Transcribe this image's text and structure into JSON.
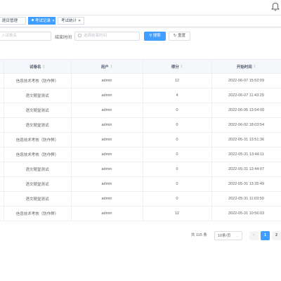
{
  "tabs": [
    {
      "label": "题目管理",
      "active": false
    },
    {
      "label": "考试记录",
      "active": true
    },
    {
      "label": "考试统计",
      "active": false
    }
  ],
  "filter": {
    "name_placeholder": "入试卷名",
    "end_time_label": "结束时间",
    "end_time_placeholder": "选择结束时间",
    "search_label": "搜索",
    "reset_label": "重置"
  },
  "table": {
    "columns": [
      "试卷名",
      "用户",
      "得分",
      "开始时间"
    ],
    "rows": [
      {
        "paper": "信息技术考核（防作弊）",
        "user": "admin",
        "score": "12",
        "start": "2022-06-07 15:52:09"
      },
      {
        "paper": "语文随堂测试",
        "user": "admin",
        "score": "4",
        "start": "2022-06-07 11:43:29"
      },
      {
        "paper": "语文随堂测试",
        "user": "admin",
        "score": "0",
        "start": "2022-06-05 13:54:00"
      },
      {
        "paper": "语文随堂测试",
        "user": "admin",
        "score": "0",
        "start": "2022-06-02 18:03:54"
      },
      {
        "paper": "信息技术考核（防作弊）",
        "user": "admin",
        "score": "0",
        "start": "2022-05-31 13:51:36"
      },
      {
        "paper": "信息技术考核（防作弊）",
        "user": "admin",
        "score": "0",
        "start": "2022-05-31 13:44:11"
      },
      {
        "paper": "语文随堂测试",
        "user": "admin",
        "score": "0",
        "start": "2022-05-31 13:44:07"
      },
      {
        "paper": "语文随堂测试",
        "user": "admin",
        "score": "0",
        "start": "2022-05-31 13:35:49"
      },
      {
        "paper": "语文随堂测试",
        "user": "admin",
        "score": "0",
        "start": "2022-05-31 11:03:50"
      },
      {
        "paper": "信息技术考核（防作弊）",
        "user": "admin",
        "score": "12",
        "start": "2022-05-31 10:56:03"
      }
    ]
  },
  "pagination": {
    "total": "共 115 条",
    "page_size": "10条/页",
    "prev": "<",
    "pages": [
      "1",
      "2"
    ],
    "current_page": "1"
  },
  "colors": {
    "primary": "#409eff",
    "header_bg": "#f5f7fa",
    "border": "#ebeef5"
  }
}
